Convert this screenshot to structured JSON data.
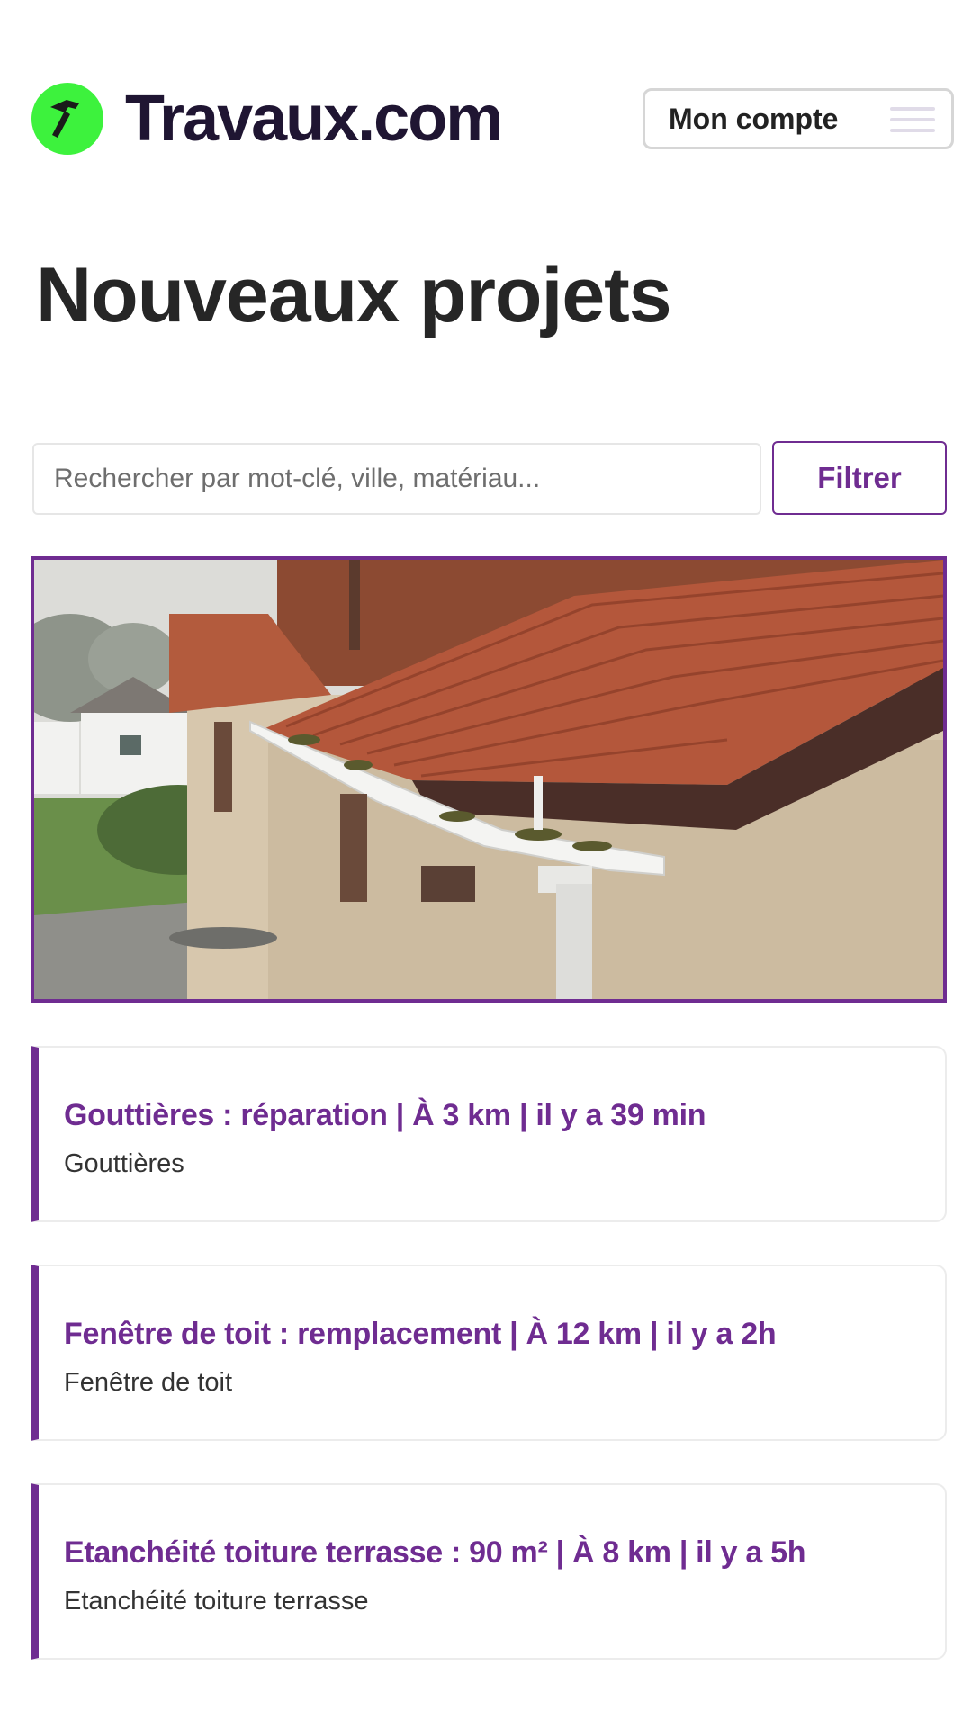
{
  "header": {
    "logo_text": "Travaux.com",
    "account_label": "Mon compte"
  },
  "page_title": "Nouveaux projets",
  "search": {
    "placeholder": "Rechercher par mot-clé, ville, matériau...",
    "filter_label": "Filtrer"
  },
  "colors": {
    "brand": "#6f2c91",
    "logo_green": "#3df23d",
    "logo_text": "#1f1532"
  },
  "projects": [
    {
      "title": "Gouttières : réparation | À 3 km | il y a 39 min",
      "category": "Gouttières"
    },
    {
      "title": "Fenêtre de toit : remplacement | À 12 km | il y a 2h",
      "category": "Fenêtre de toit"
    },
    {
      "title": "Etanchéité toiture terrasse : 90 m² | À 8 km | il y a 5h",
      "category": "Etanchéité toiture terrasse"
    }
  ]
}
